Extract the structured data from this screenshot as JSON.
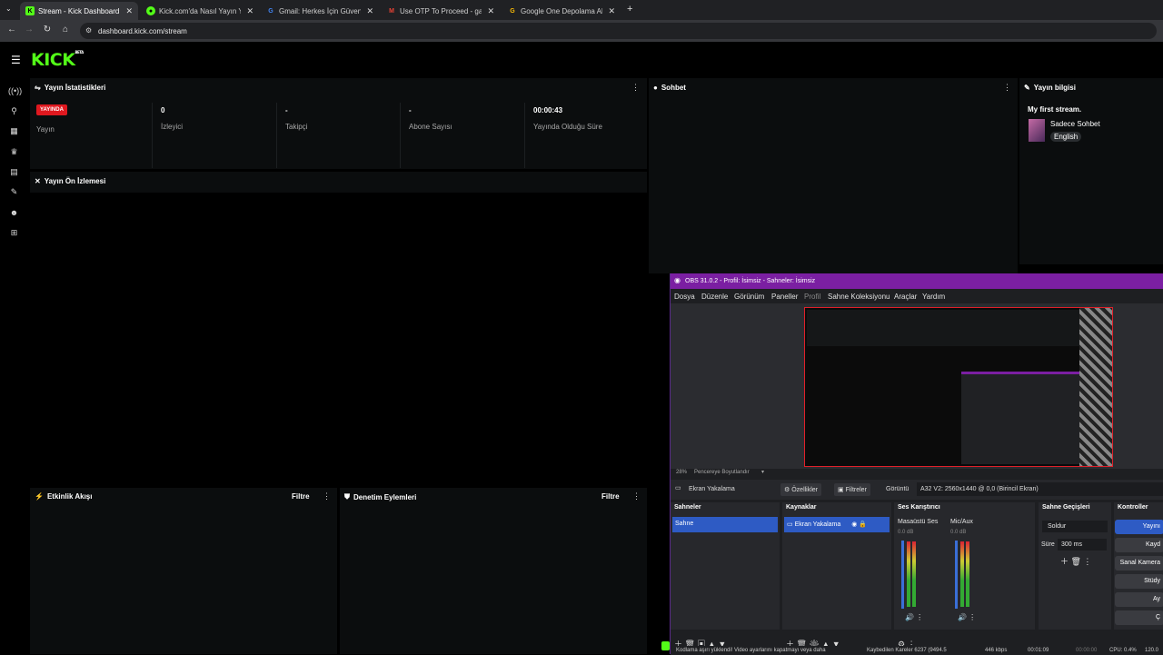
{
  "browser": {
    "tabs": [
      {
        "label": "Stream - Kick Dashboard",
        "active": true
      },
      {
        "label": "Kick.com'da Nasıl Yayın Yapılır",
        "active": false
      },
      {
        "label": "Gmail: Herkes İçin Güvenli, Yap",
        "active": false
      },
      {
        "label": "Use OTP To Proceed - gasefe0",
        "active": false
      },
      {
        "label": "Google One Depolama Alanı Y",
        "active": false
      }
    ],
    "new_tab": "+",
    "url": "dashboard.kick.com/stream"
  },
  "kick": {
    "logo": "KICK",
    "logo_badge": "BETA",
    "stats_panel": {
      "title": "Yayın İstatistikleri",
      "live_badge": "YAYINDA",
      "stats": [
        {
          "value": "",
          "label": "Yayın"
        },
        {
          "value": "0",
          "label": "İzleyici"
        },
        {
          "value": "-",
          "label": "Takipçi"
        },
        {
          "value": "-",
          "label": "Abone Sayısı"
        },
        {
          "value": "00:00:43",
          "label": "Yayında Olduğu Süre"
        }
      ]
    },
    "preview_panel": {
      "title": "Yayın Ön İzlemesi"
    },
    "chat_panel": {
      "title": "Sohbet"
    },
    "info_panel": {
      "title": "Yayın bilgisi",
      "stream_title": "My first stream.",
      "category": "Sadece Sohbet",
      "language": "English"
    },
    "activity_panel": {
      "title": "Etkinlik Akışı",
      "filter": "Filtre"
    },
    "moderation_panel": {
      "title": "Denetim Eylemleri",
      "filter": "Filtre"
    }
  },
  "obs": {
    "title": "OBS 31.0.2 - Profil: İsimsiz - Sahneler: İsimsiz",
    "menu": [
      "Dosya",
      "Düzenle",
      "Görünüm",
      "Paneller",
      "Profil",
      "Sahne Koleksiyonu",
      "Araçlar",
      "Yardım"
    ],
    "zoom": "28%",
    "resize_label": "Pencereye Boyutlandır",
    "source_name": "Ekran Yakalama",
    "properties_btn": "Özellikler",
    "filters_btn": "Filtreler",
    "display_label": "Görüntü",
    "display_value": "A32 V2: 2560x1440 @ 0,0 (Birincil Ekran)",
    "docks": {
      "scenes": {
        "title": "Sahneler",
        "items": [
          "Sahne"
        ]
      },
      "sources": {
        "title": "Kaynaklar",
        "items": [
          "Ekran Yakalama"
        ]
      },
      "mixer": {
        "title": "Ses Karıştırıcı",
        "channels": [
          {
            "name": "Masaüstü Ses",
            "db": "0.0 dB"
          },
          {
            "name": "Mic/Aux",
            "db": "0.0 dB"
          }
        ]
      },
      "transitions": {
        "title": "Sahne Geçişleri",
        "type": "Soldur",
        "duration_label": "Süre",
        "duration": "300 ms"
      },
      "controls": {
        "title": "Kontroller",
        "buttons": [
          "Yayını",
          "Kayd",
          "Sanal Kamera",
          "Stüdy",
          "Ay",
          "Ç"
        ]
      }
    },
    "status": {
      "message": "Kodlama aşırı yüklendi! Video ayarlarını kapatmayı veya daha",
      "dropped": "Kaybedilen Kareler 6237 (9494.5",
      "bitrate": "446 kbps",
      "rec_time": "00:01:09",
      "stream_time": "00:00:00",
      "cpu": "CPU: 0.4%",
      "fps": "120.0"
    }
  }
}
